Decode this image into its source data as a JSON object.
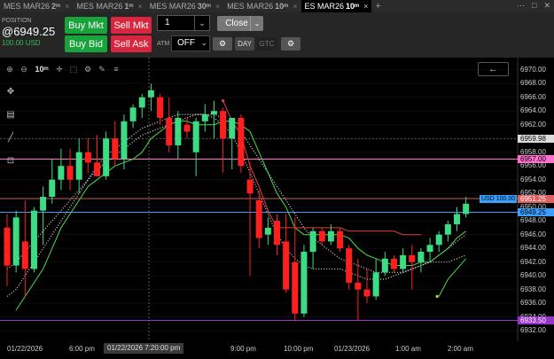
{
  "tabs": [
    {
      "symbol": "MES MAR26",
      "interval": "2ᵐ",
      "active": false
    },
    {
      "symbol": "MES MAR26",
      "interval": "1ᵐ",
      "active": false
    },
    {
      "symbol": "MES MAR26",
      "interval": "30ᵐ",
      "active": false
    },
    {
      "symbol": "MES MAR26",
      "interval": "10ᵐ",
      "active": false
    },
    {
      "symbol": "ES MAR26",
      "interval": "10ᵐ",
      "active": true
    }
  ],
  "tab_close": "×",
  "tab_add": "+",
  "window_controls": [
    "⋯",
    "□",
    "✕"
  ],
  "position": {
    "label": "POSITION",
    "price": "@6949.25",
    "pnl": "100.00 USD"
  },
  "order": {
    "buy_mkt": "Buy Mkt",
    "sell_mkt": "Sell Mkt",
    "buy_bid": "Buy Bid",
    "sell_ask": "Sell Ask",
    "quantity": "1",
    "close": "Close",
    "atm_label": "ATM",
    "atm_value": "OFF",
    "tif_day": "DAY",
    "tif_gtc": "GTC"
  },
  "chart_toolbar": {
    "zoom_in": "⊕",
    "zoom_out": "⊖",
    "interval": "10ᵐ",
    "back": "←"
  },
  "price_axis": {
    "ticks": [
      "6970.00",
      "6968.00",
      "6966.00",
      "6964.00",
      "6962.00",
      "6960.00",
      "6958.00",
      "6956.00",
      "6954.00",
      "6952.00",
      "6950.00",
      "6948.00",
      "6946.00",
      "6944.00",
      "6942.00",
      "6940.00",
      "6938.00",
      "6936.00",
      "6934.00",
      "6932.00"
    ],
    "tag_crosshair": "6959.98",
    "tag_pink": "6957.00",
    "tag_red": "6951.25",
    "tag_blue": "6949.25",
    "tag_purple": "6933.50",
    "position_tag": "USD 100.00"
  },
  "time_axis": {
    "labels": [
      "01/22/2026",
      "6:00 pm",
      "9:00 pm",
      "10:00 pm",
      "01/23/2026",
      "1:00 am",
      "2:00 am"
    ],
    "crosshair": "01/22/2026 7:20:00 pm"
  },
  "colors": {
    "up": "#3ddc84",
    "down": "#ff1f1f",
    "fast_line": "#4cd94c",
    "step_line": "#e04040",
    "pink": "#ff70d0",
    "blue": "#3aa0ff",
    "purple": "#9933cc",
    "crosshair": "#3a3a3a"
  },
  "chart_data": {
    "type": "candlestick",
    "ylim": [
      6931.5,
      6971
    ],
    "candles": [
      {
        "o": 6947.0,
        "h": 6949.0,
        "l": 6938.5,
        "c": 6941.5
      },
      {
        "o": 6941.5,
        "h": 6949.5,
        "l": 6940.5,
        "c": 6948.5
      },
      {
        "o": 6945.0,
        "h": 6951.0,
        "l": 6937.0,
        "c": 6941.0
      },
      {
        "o": 6941.0,
        "h": 6950.0,
        "l": 6940.5,
        "c": 6949.5
      },
      {
        "o": 6949.5,
        "h": 6953.0,
        "l": 6944.5,
        "c": 6951.5
      },
      {
        "o": 6951.5,
        "h": 6957.0,
        "l": 6950.5,
        "c": 6954.0
      },
      {
        "o": 6954.0,
        "h": 6958.5,
        "l": 6952.5,
        "c": 6956.0
      },
      {
        "o": 6956.0,
        "h": 6958.5,
        "l": 6952.5,
        "c": 6954.0
      },
      {
        "o": 6954.0,
        "h": 6960.0,
        "l": 6952.0,
        "c": 6958.0
      },
      {
        "o": 6958.0,
        "h": 6960.0,
        "l": 6955.0,
        "c": 6956.5
      },
      {
        "o": 6956.5,
        "h": 6960.5,
        "l": 6954.5,
        "c": 6954.5
      },
      {
        "o": 6954.5,
        "h": 6961.0,
        "l": 6954.0,
        "c": 6960.0
      },
      {
        "o": 6960.0,
        "h": 6962.5,
        "l": 6956.0,
        "c": 6957.0
      },
      {
        "o": 6957.0,
        "h": 6963.5,
        "l": 6955.5,
        "c": 6962.5
      },
      {
        "o": 6962.5,
        "h": 6965.0,
        "l": 6961.5,
        "c": 6964.5
      },
      {
        "o": 6964.5,
        "h": 6966.5,
        "l": 6963.0,
        "c": 6966.0
      },
      {
        "o": 6966.0,
        "h": 6968.0,
        "l": 6964.0,
        "c": 6967.0
      },
      {
        "o": 6966.0,
        "h": 6966.5,
        "l": 6962.0,
        "c": 6963.0
      },
      {
        "o": 6963.0,
        "h": 6966.0,
        "l": 6958.0,
        "c": 6959.0
      },
      {
        "o": 6959.0,
        "h": 6964.0,
        "l": 6957.0,
        "c": 6963.0
      },
      {
        "o": 6962.0,
        "h": 6963.0,
        "l": 6960.0,
        "c": 6961.0
      },
      {
        "o": 6958.0,
        "h": 6963.0,
        "l": 6954.5,
        "c": 6962.5
      },
      {
        "o": 6962.5,
        "h": 6965.0,
        "l": 6961.0,
        "c": 6963.5
      },
      {
        "o": 6963.5,
        "h": 6965.5,
        "l": 6960.0,
        "c": 6964.0
      },
      {
        "o": 6964.0,
        "h": 6964.5,
        "l": 6955.0,
        "c": 6960.0
      },
      {
        "o": 6960.0,
        "h": 6961.5,
        "l": 6955.5,
        "c": 6963.0
      },
      {
        "o": 6963.0,
        "h": 6963.5,
        "l": 6955.0,
        "c": 6956.0
      },
      {
        "o": 6954.0,
        "h": 6956.5,
        "l": 6940.0,
        "c": 6952.0
      },
      {
        "o": 6951.0,
        "h": 6952.5,
        "l": 6944.0,
        "c": 6945.5
      },
      {
        "o": 6946.0,
        "h": 6948.5,
        "l": 6944.5,
        "c": 6947.0
      },
      {
        "o": 6948.0,
        "h": 6949.0,
        "l": 6943.0,
        "c": 6944.5
      },
      {
        "o": 6945.0,
        "h": 6949.0,
        "l": 6937.5,
        "c": 6938.0
      },
      {
        "o": 6942.0,
        "h": 6948.5,
        "l": 6933.5,
        "c": 6934.5
      },
      {
        "o": 6934.5,
        "h": 6944.5,
        "l": 6934.0,
        "c": 6943.5
      },
      {
        "o": 6943.5,
        "h": 6947.0,
        "l": 6941.0,
        "c": 6946.5
      },
      {
        "o": 6946.5,
        "h": 6947.0,
        "l": 6944.5,
        "c": 6945.0
      },
      {
        "o": 6945.0,
        "h": 6947.5,
        "l": 6944.5,
        "c": 6946.5
      },
      {
        "o": 6946.5,
        "h": 6947.0,
        "l": 6943.5,
        "c": 6944.0
      },
      {
        "o": 6944.0,
        "h": 6944.5,
        "l": 6938.0,
        "c": 6939.0
      },
      {
        "o": 6939.0,
        "h": 6942.5,
        "l": 6933.5,
        "c": 6938.0
      },
      {
        "o": 6938.0,
        "h": 6941.0,
        "l": 6936.0,
        "c": 6937.0
      },
      {
        "o": 6937.0,
        "h": 6942.5,
        "l": 6936.5,
        "c": 6940.5
      },
      {
        "o": 6940.5,
        "h": 6943.5,
        "l": 6940.0,
        "c": 6942.5
      },
      {
        "o": 6942.5,
        "h": 6943.0,
        "l": 6940.5,
        "c": 6941.0
      },
      {
        "o": 6941.0,
        "h": 6944.0,
        "l": 6940.5,
        "c": 6943.0
      },
      {
        "o": 6943.0,
        "h": 6944.5,
        "l": 6938.0,
        "c": 6942.0
      },
      {
        "o": 6942.0,
        "h": 6944.0,
        "l": 6940.5,
        "c": 6943.5
      },
      {
        "o": 6943.5,
        "h": 6945.5,
        "l": 6942.0,
        "c": 6944.5
      },
      {
        "o": 6944.5,
        "h": 6946.5,
        "l": 6943.5,
        "c": 6946.0
      },
      {
        "o": 6946.0,
        "h": 6948.0,
        "l": 6945.0,
        "c": 6947.5
      },
      {
        "o": 6947.5,
        "h": 6950.0,
        "l": 6946.5,
        "c": 6949.0
      },
      {
        "o": 6949.0,
        "h": 6951.5,
        "l": 6948.5,
        "c": 6950.5
      }
    ],
    "fast_ma": [
      null,
      6935,
      6937,
      6939,
      6941,
      6944,
      6947,
      6949,
      6951,
      6953,
      6954,
      6955,
      6956,
      6956.5,
      6957,
      6958,
      6960,
      6961,
      6962,
      6962.5,
      6962.5,
      6962,
      6962,
      6962,
      6962.5,
      6962.5,
      6962,
      6961,
      6958,
      6955,
      6952,
      6950,
      6947,
      6946,
      6946,
      6946,
      6946,
      6946,
      6945.5,
      6944,
      6943,
      6942.5,
      6942,
      6941.5,
      6941.5,
      6941.5,
      6942,
      6942,
      6943,
      6944,
      6945.5,
      6946.5
    ],
    "step_line": [
      null,
      null,
      null,
      null,
      null,
      null,
      null,
      null,
      null,
      null,
      null,
      null,
      null,
      null,
      null,
      null,
      null,
      null,
      null,
      null,
      null,
      null,
      null,
      null,
      6965.5,
      6962.5,
      6960.5,
      6956,
      6953,
      6949.5,
      6947,
      6947,
      6947,
      6947,
      6947,
      6947,
      6947,
      6947,
      6946.5,
      6946.5,
      6946.5,
      6946.5,
      6946.5,
      6946.5,
      6946,
      6946,
      6946,
      null,
      null,
      null,
      null,
      null
    ],
    "dotted_slow": [
      6941,
      6942,
      6943.5,
      6945,
      6946.5,
      6948,
      6949.5,
      6951,
      6952.5,
      6954,
      6955.5,
      6956.5,
      6957.5,
      6958.5,
      6959.5,
      6960.5,
      6961,
      6961.5,
      6962,
      6962.5,
      6963,
      6963.5,
      6963.5,
      6963.5,
      6963,
      6962,
      6961,
      6959,
      6957,
      6955,
      6953,
      6951,
      6949,
      6947,
      6945.5,
      6944.5,
      6943.5,
      6942.5,
      6942,
      6941.5,
      6941,
      6940.5,
      6940.5,
      6940.5,
      6940.5,
      6941,
      6941.5,
      6942,
      6943,
      6944,
      6945,
      6946
    ],
    "dotted_fast": [
      6937,
      6938,
      6940,
      6942,
      6944,
      6946,
      6948,
      6950,
      6952,
      6954,
      6956,
      6957.5,
      6958.5,
      6959.5,
      6960.5,
      6961.5,
      6962,
      6962.5,
      6963,
      6963.5,
      6963.5,
      6963.5,
      6963.5,
      6963,
      6962,
      6960.5,
      6958,
      6955,
      6952,
      6949,
      6946,
      6944,
      6942.5,
      6941.5,
      6941,
      6941,
      6941,
      6941,
      6940.5,
      6940,
      6939.5,
      6939.5,
      6939.5,
      6940,
      6940.5,
      6941,
      6941.5,
      6942,
      6942,
      6942,
      6942.5,
      6943
    ],
    "green_tail": [
      null,
      null,
      null,
      null,
      null,
      null,
      null,
      null,
      null,
      null,
      null,
      null,
      null,
      null,
      null,
      null,
      null,
      null,
      null,
      null,
      null,
      null,
      null,
      null,
      null,
      null,
      null,
      null,
      null,
      null,
      null,
      null,
      null,
      null,
      null,
      null,
      null,
      null,
      null,
      null,
      null,
      null,
      null,
      null,
      null,
      null,
      null,
      null,
      6937,
      6939.5,
      6941,
      6942.5
    ],
    "hlines": {
      "crosshair": 6959.98,
      "pink": 6957.0,
      "red": 6951.25,
      "blue": 6949.25,
      "purple": 6933.5
    }
  }
}
